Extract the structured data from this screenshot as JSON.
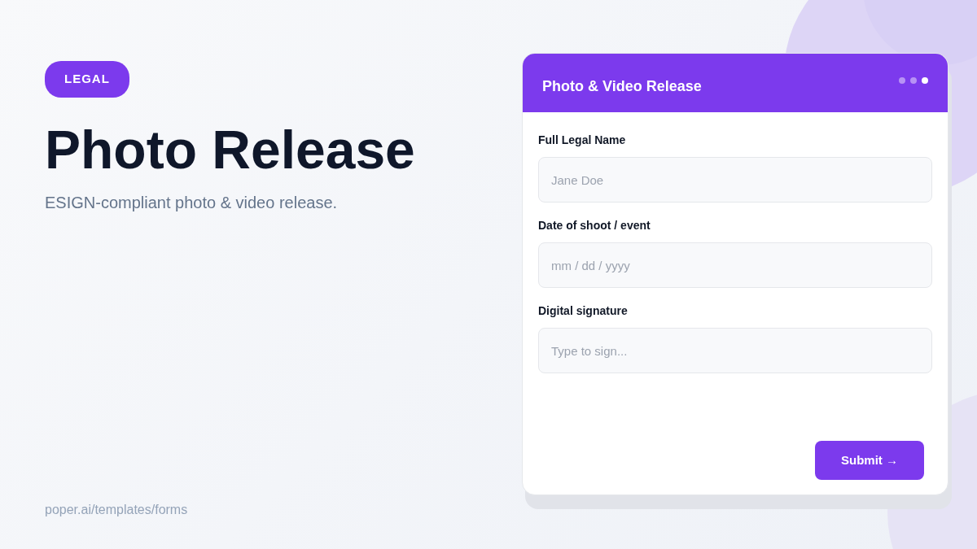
{
  "badge": "LEGAL",
  "title": "Photo Release",
  "subtitle": "ESIGN-compliant photo & video release.",
  "footer_link": "poper.ai/templates/forms",
  "form": {
    "title": "Photo & Video Release",
    "steps": [
      {
        "selected": false
      },
      {
        "selected": false
      },
      {
        "selected": true
      }
    ],
    "fields": [
      {
        "label": "Full Legal Name",
        "placeholder": "Jane Doe"
      },
      {
        "label": "Date of shoot / event",
        "placeholder": "mm / dd / yyyy"
      },
      {
        "label": "Digital signature",
        "placeholder": "Type to sign..."
      }
    ],
    "submit": "Submit →"
  }
}
